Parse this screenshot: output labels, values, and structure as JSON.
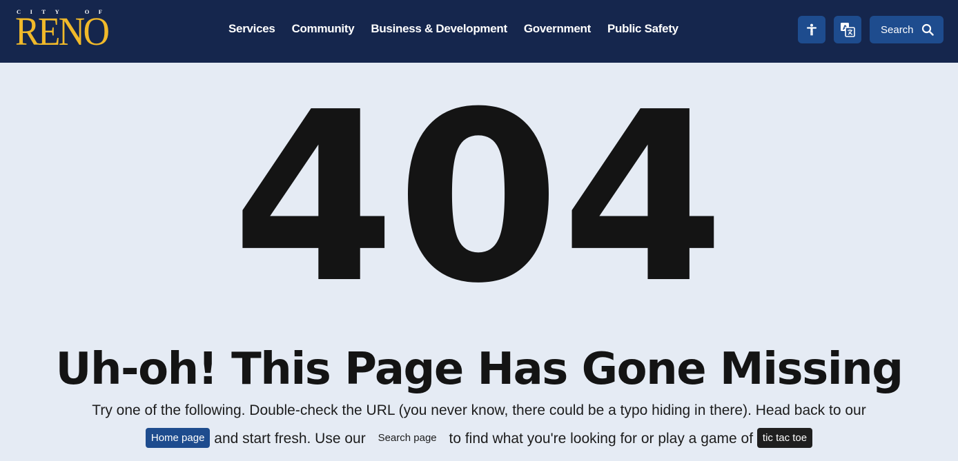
{
  "header": {
    "logo_small_letters": [
      "C",
      "I",
      "T",
      "Y",
      "O",
      "F"
    ],
    "logo_big": "RENO",
    "nav": [
      "Services",
      "Community",
      "Business & Development",
      "Government",
      "Public Safety"
    ],
    "accessibility_icon": "accessibility-person-icon",
    "translate_icon": "translate-icon",
    "search_label": "Search",
    "search_icon": "search-icon"
  },
  "main": {
    "error_code": "404",
    "heading": "Uh-oh! This Page Has Gone Missing",
    "line1": "Try one of the following. Double-check the URL (you never know, there could be a typo hiding in there). Head back to our",
    "home_link": "Home page",
    "text_a": "and start fresh. Use our",
    "search_link": "Search page",
    "text_b": "to find what you're looking for or play a game of",
    "ttt_link": "tic tac toe"
  },
  "colors": {
    "header_bg": "#15264d",
    "logo_gold": "#f0b92a",
    "button_blue": "#1e4c8e",
    "page_bg": "#e5ebf4",
    "text_dark": "#141414"
  }
}
